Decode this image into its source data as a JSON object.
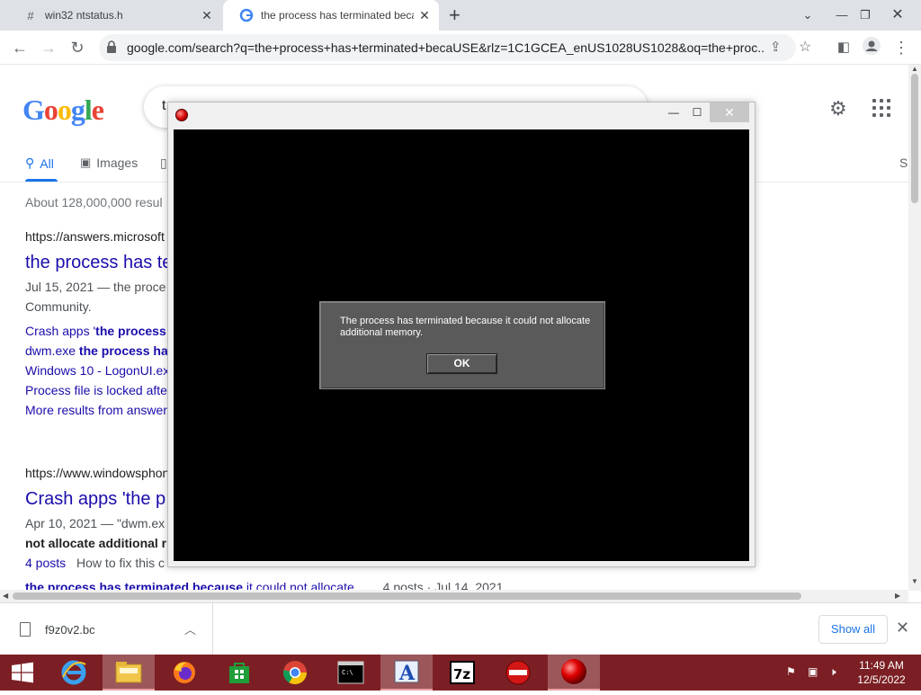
{
  "browser": {
    "tabs": [
      {
        "label": "win32 ntstatus.h",
        "favicon": "#"
      },
      {
        "label": "the process has terminated beca",
        "favicon": "G"
      }
    ],
    "address": "google.com/search?q=the+process+has+terminated+becaUSE&rlz=1C1GCEA_enUS1028US1028&oq=the+proc..."
  },
  "google": {
    "logo": "Google",
    "query": "t",
    "tabs": {
      "all": "All",
      "images": "Images",
      "more": "S"
    },
    "stats": "About 128,000,000 resul",
    "results": [
      {
        "cite": "https://answers.microsoft",
        "title": "the process has te",
        "snippet_line1": "Jul 15, 2021 — the proce",
        "snippet_line2": "Community.",
        "sublinks": [
          {
            "pre": "Crash apps '",
            "bold": "the process"
          },
          {
            "pre": "dwm.exe ",
            "bold": "the process ha"
          },
          {
            "pre": "Windows 10 - LogonUI.ex",
            "bold": ""
          },
          {
            "pre": "Process file is locked afte",
            "bold": ""
          },
          {
            "pre": "More results from answer",
            "bold": ""
          }
        ]
      },
      {
        "cite": "https://www.windowsphon",
        "title": "Crash apps 'the p",
        "snippet_line1": "Apr 10, 2021 — \"dwm.ex",
        "snippet_bold": "not allocate additional r",
        "posts_link": "4 posts",
        "posts_text": "How to fix this c",
        "partial_bold": "the process has terminated because",
        "partial_text": " it could not allocate",
        "partial_meta": "4 posts · Jul 14, 2021"
      }
    ]
  },
  "app_window": {
    "dialog_message": "The process has terminated because it could not allocate additional memory.",
    "ok_label": "OK"
  },
  "downloads": {
    "file": "f9z0v2.bc",
    "show_all": "Show all"
  },
  "taskbar": {
    "time": "11:49 AM",
    "date": "12/5/2022",
    "apps": [
      "internet-explorer",
      "file-explorer",
      "firefox",
      "windows-store",
      "chrome",
      "command-prompt",
      "font-app",
      "7zip",
      "no-entry-app",
      "red-ball-app"
    ]
  },
  "colors": {
    "taskbar": "#7b1f24",
    "link": "#1a0dab",
    "accent": "#1a73e8"
  }
}
